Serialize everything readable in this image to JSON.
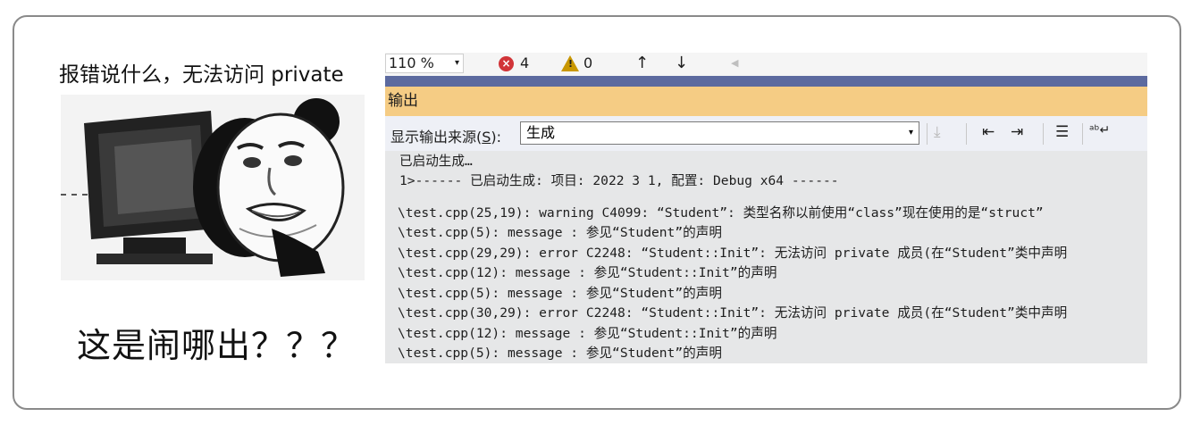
{
  "meme": {
    "caption_top": "报错说什么，无法访问 private",
    "caption_bottom": "这是闹哪出？？？"
  },
  "vs": {
    "statusbar": {
      "zoom": "110 %",
      "errors": "4",
      "warnings": "0"
    },
    "panel_title": "输出",
    "toolbar": {
      "source_label_pre": "显示输出来源(",
      "source_label_key": "S",
      "source_label_post": "):",
      "source_value": "生成"
    },
    "output_lines": [
      "已启动生成…",
      "1>------ 已启动生成: 项目: 2022 3 1, 配置: Debug x64 ------",
      "\\test.cpp(25,19): warning C4099: “Student”: 类型名称以前使用“class”现在使用的是“struct”",
      "\\test.cpp(5): message : 参见“Student”的声明",
      "\\test.cpp(29,29): error C2248: “Student::Init”: 无法访问 private 成员(在“Student”类中声明",
      "\\test.cpp(12): message : 参见“Student::Init”的声明",
      "\\test.cpp(5): message : 参见“Student”的声明",
      "\\test.cpp(30,29): error C2248: “Student::Init”: 无法访问 private 成员(在“Student”类中声明",
      "\\test.cpp(12): message : 参见“Student::Init”的声明",
      "\\test.cpp(5): message : 参见“Student”的声明"
    ]
  }
}
